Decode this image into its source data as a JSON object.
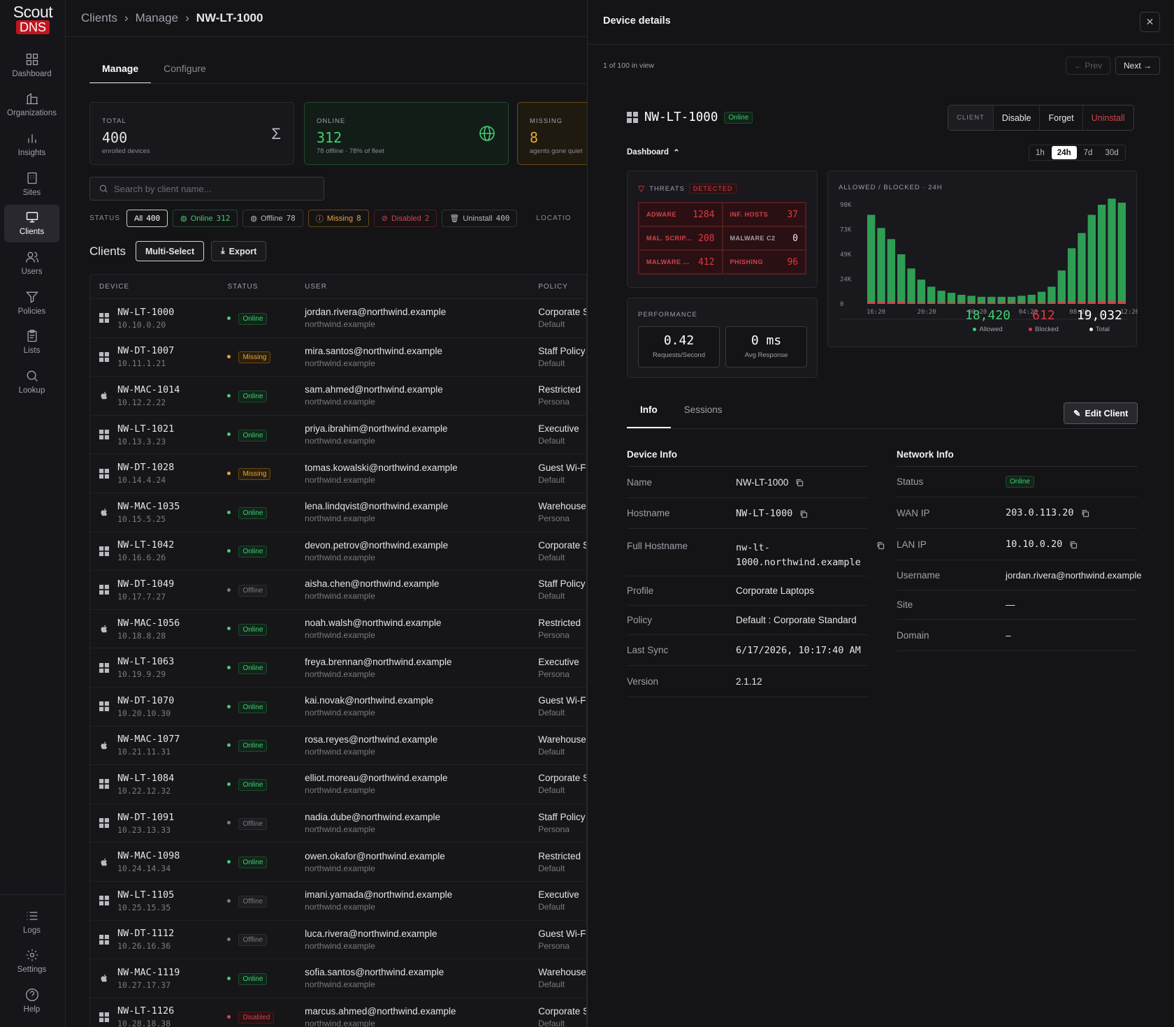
{
  "logo": {
    "line1": "Scout",
    "line2": "DNS"
  },
  "nav": [
    {
      "label": "Dashboard",
      "icon": "dashboard-icon"
    },
    {
      "label": "Organizations",
      "icon": "organizations-icon"
    },
    {
      "label": "Insights",
      "icon": "insights-icon"
    },
    {
      "label": "Sites",
      "icon": "sites-icon"
    },
    {
      "label": "Clients",
      "icon": "clients-icon",
      "active": true
    },
    {
      "label": "Users",
      "icon": "users-icon"
    },
    {
      "label": "Policies",
      "icon": "policies-icon"
    },
    {
      "label": "Lists",
      "icon": "lists-icon"
    },
    {
      "label": "Lookup",
      "icon": "lookup-icon"
    }
  ],
  "nav_bottom": [
    {
      "label": "Logs",
      "icon": "logs-icon"
    },
    {
      "label": "Settings",
      "icon": "gear-icon"
    },
    {
      "label": "Help",
      "icon": "help-icon"
    }
  ],
  "breadcrumb": {
    "a": "Clients",
    "b": "Manage",
    "c": "NW-LT-1000",
    "sep": "›"
  },
  "tabs": {
    "manage": "Manage",
    "configure": "Configure"
  },
  "stats": {
    "total": {
      "label": "TOTAL",
      "value": "400",
      "sub": "enrolled devices",
      "icon": "Σ"
    },
    "online": {
      "label": "ONLINE",
      "value": "312",
      "sub": "78 offline · 78% of fleet"
    },
    "missing": {
      "label": "MISSING",
      "value": "8",
      "sub": "agents gone quiet"
    }
  },
  "search": {
    "placeholder": "Search by client name..."
  },
  "status_filter": {
    "label": "STATUS",
    "all": {
      "label": "All",
      "count": "400"
    },
    "online": {
      "label": "Online",
      "count": "312"
    },
    "offline": {
      "label": "Offline",
      "count": "78"
    },
    "missing": {
      "label": "Missing",
      "count": "8"
    },
    "disabled": {
      "label": "Disabled",
      "count": "2"
    },
    "uninstall": {
      "label": "Uninstall",
      "count": "400"
    },
    "location_label": "LOCATIO"
  },
  "clients_section": {
    "title": "Clients",
    "multi_select": "Multi-Select",
    "export": "Export"
  },
  "table": {
    "headers": {
      "device": "DEVICE",
      "status": "STATUS",
      "user": "USER",
      "policy": "POLICY"
    },
    "rows": [
      {
        "name": "NW-LT-1000",
        "ip": "10.10.0.20",
        "os": "windows",
        "status": "Online",
        "email": "jordan.rivera@northwind.example",
        "domain": "northwind.example",
        "policy": "Corporate S",
        "sub": "Default"
      },
      {
        "name": "NW-DT-1007",
        "ip": "10.11.1.21",
        "os": "windows",
        "status": "Missing",
        "email": "mira.santos@northwind.example",
        "domain": "northwind.example",
        "policy": "Staff Policy",
        "sub": "Default"
      },
      {
        "name": "NW-MAC-1014",
        "ip": "10.12.2.22",
        "os": "apple",
        "status": "Online",
        "email": "sam.ahmed@northwind.example",
        "domain": "northwind.example",
        "policy": "Restricted",
        "sub": "Persona"
      },
      {
        "name": "NW-LT-1021",
        "ip": "10.13.3.23",
        "os": "windows",
        "status": "Online",
        "email": "priya.ibrahim@northwind.example",
        "domain": "northwind.example",
        "policy": "Executive",
        "sub": "Default"
      },
      {
        "name": "NW-DT-1028",
        "ip": "10.14.4.24",
        "os": "windows",
        "status": "Missing",
        "email": "tomas.kowalski@northwind.example",
        "domain": "northwind.example",
        "policy": "Guest Wi-F",
        "sub": "Default"
      },
      {
        "name": "NW-MAC-1035",
        "ip": "10.15.5.25",
        "os": "apple",
        "status": "Online",
        "email": "lena.lindqvist@northwind.example",
        "domain": "northwind.example",
        "policy": "Warehouse",
        "sub": "Persona"
      },
      {
        "name": "NW-LT-1042",
        "ip": "10.16.6.26",
        "os": "windows",
        "status": "Online",
        "email": "devon.petrov@northwind.example",
        "domain": "northwind.example",
        "policy": "Corporate S",
        "sub": "Default"
      },
      {
        "name": "NW-DT-1049",
        "ip": "10.17.7.27",
        "os": "windows",
        "status": "Offline",
        "email": "aisha.chen@northwind.example",
        "domain": "northwind.example",
        "policy": "Staff Policy",
        "sub": "Default"
      },
      {
        "name": "NW-MAC-1056",
        "ip": "10.18.8.28",
        "os": "apple",
        "status": "Online",
        "email": "noah.walsh@northwind.example",
        "domain": "northwind.example",
        "policy": "Restricted",
        "sub": "Persona"
      },
      {
        "name": "NW-LT-1063",
        "ip": "10.19.9.29",
        "os": "windows",
        "status": "Online",
        "email": "freya.brennan@northwind.example",
        "domain": "northwind.example",
        "policy": "Executive",
        "sub": "Persona"
      },
      {
        "name": "NW-DT-1070",
        "ip": "10.20.10.30",
        "os": "windows",
        "status": "Online",
        "email": "kai.novak@northwind.example",
        "domain": "northwind.example",
        "policy": "Guest Wi-F",
        "sub": "Default"
      },
      {
        "name": "NW-MAC-1077",
        "ip": "10.21.11.31",
        "os": "apple",
        "status": "Online",
        "email": "rosa.reyes@northwind.example",
        "domain": "northwind.example",
        "policy": "Warehouse",
        "sub": "Default"
      },
      {
        "name": "NW-LT-1084",
        "ip": "10.22.12.32",
        "os": "windows",
        "status": "Online",
        "email": "elliot.moreau@northwind.example",
        "domain": "northwind.example",
        "policy": "Corporate S",
        "sub": "Default"
      },
      {
        "name": "NW-DT-1091",
        "ip": "10.23.13.33",
        "os": "windows",
        "status": "Offline",
        "email": "nadia.dube@northwind.example",
        "domain": "northwind.example",
        "policy": "Staff Policy",
        "sub": "Persona"
      },
      {
        "name": "NW-MAC-1098",
        "ip": "10.24.14.34",
        "os": "apple",
        "status": "Online",
        "email": "owen.okafor@northwind.example",
        "domain": "northwind.example",
        "policy": "Restricted",
        "sub": "Default"
      },
      {
        "name": "NW-LT-1105",
        "ip": "10.25.15.35",
        "os": "windows",
        "status": "Offline",
        "email": "imani.yamada@northwind.example",
        "domain": "northwind.example",
        "policy": "Executive",
        "sub": "Default"
      },
      {
        "name": "NW-DT-1112",
        "ip": "10.26.16.36",
        "os": "windows",
        "status": "Offline",
        "email": "luca.rivera@northwind.example",
        "domain": "northwind.example",
        "policy": "Guest Wi-F",
        "sub": "Persona"
      },
      {
        "name": "NW-MAC-1119",
        "ip": "10.27.17.37",
        "os": "apple",
        "status": "Online",
        "email": "sofia.santos@northwind.example",
        "domain": "northwind.example",
        "policy": "Warehouse",
        "sub": "Default"
      },
      {
        "name": "NW-LT-1126",
        "ip": "10.28.18.38",
        "os": "windows",
        "status": "Disabled",
        "email": "marcus.ahmed@northwind.example",
        "domain": "northwind.example",
        "policy": "Corporate S",
        "sub": "Default"
      }
    ]
  },
  "drawer": {
    "title": "Device details",
    "close": "✕",
    "count": "1 of 100 in view",
    "prev": "← Prev",
    "next": "Next →",
    "device_name": "NW-LT-1000",
    "device_status": "Online",
    "actions": {
      "label": "CLIENT",
      "disable": "Disable",
      "forget": "Forget",
      "uninstall": "Uninstall"
    },
    "dashboard_label": "Dashboard",
    "ranges": [
      "1h",
      "24h",
      "7d",
      "30d"
    ],
    "active_range": "24h",
    "threats": {
      "label": "THREATS",
      "badge": "DETECTED",
      "items": [
        {
          "k": "ADWARE",
          "v": "1284"
        },
        {
          "k": "INF. HOSTS",
          "v": "37"
        },
        {
          "k": "MAL. SCRIP...",
          "v": "208"
        },
        {
          "k": "MALWARE C2",
          "v": "0"
        },
        {
          "k": "MALWARE ...",
          "v": "412"
        },
        {
          "k": "PHISHING",
          "v": "96"
        }
      ]
    },
    "performance": {
      "label": "PERFORMANCE",
      "rps": "0.42",
      "rps_label": "Requests/Second",
      "avg": "0 ms",
      "avg_label": "Avg Response"
    },
    "totals": {
      "allowed": "18,420",
      "allowed_label": "Allowed",
      "blocked": "612",
      "blocked_label": "Blocked",
      "total": "19,032",
      "total_label": "Total"
    },
    "info_tabs": {
      "info": "Info",
      "sessions": "Sessions"
    },
    "edit_client": "Edit Client",
    "device_info": {
      "title": "Device Info",
      "name_k": "Name",
      "name_v": "NW-LT-1000",
      "hostname_k": "Hostname",
      "hostname_v": "NW-LT-1000",
      "full_k": "Full Hostname",
      "full_v1": "nw-lt-",
      "full_v2": "1000.northwind.example",
      "profile_k": "Profile",
      "profile_v": "Corporate Laptops",
      "policy_k": "Policy",
      "policy_v": "Default : Corporate Standard",
      "sync_k": "Last Sync",
      "sync_v": "6/17/2026, 10:17:40 AM",
      "version_k": "Version",
      "version_v": "2.1.12"
    },
    "network_info": {
      "title": "Network Info",
      "status_k": "Status",
      "status_v": "Online",
      "wan_k": "WAN IP",
      "wan_v": "203.0.113.20",
      "lan_k": "LAN IP",
      "lan_v": "10.10.0.20",
      "user_k": "Username",
      "user_v": "jordan.rivera@northwind.example",
      "site_k": "Site",
      "site_v": "—",
      "domain_k": "Domain",
      "domain_v": "–"
    }
  },
  "colors": {
    "allowed": "#2e9e55",
    "blocked": "#d2444c",
    "online": "#3fcf73",
    "missing": "#e6a43a"
  },
  "chart_data": {
    "type": "bar",
    "title": "ALLOWED / BLOCKED · 24H",
    "x_ticks": [
      "16:20",
      "20:20",
      "00:20",
      "04:20",
      "08:20",
      "12:20"
    ],
    "y_ticks": [
      "98K",
      "73K",
      "49K",
      "24K",
      "0"
    ],
    "ylim": [
      0,
      98000
    ],
    "series": [
      {
        "name": "Allowed",
        "values": [
          88000,
          75000,
          64000,
          49000,
          35000,
          24000,
          17000,
          13000,
          11000,
          9000,
          8000,
          7000,
          7000,
          7000,
          7000,
          8000,
          9000,
          12000,
          17000,
          33000,
          55000,
          70000,
          88000,
          98000,
          104000,
          100000
        ]
      },
      {
        "name": "Blocked",
        "values": [
          2000,
          2000,
          2000,
          2000,
          1500,
          1500,
          1500,
          1000,
          1000,
          1000,
          1000,
          1000,
          1000,
          1000,
          1000,
          1000,
          1000,
          1000,
          1500,
          2000,
          2000,
          2000,
          2500,
          3000,
          3000,
          3000
        ]
      }
    ]
  }
}
